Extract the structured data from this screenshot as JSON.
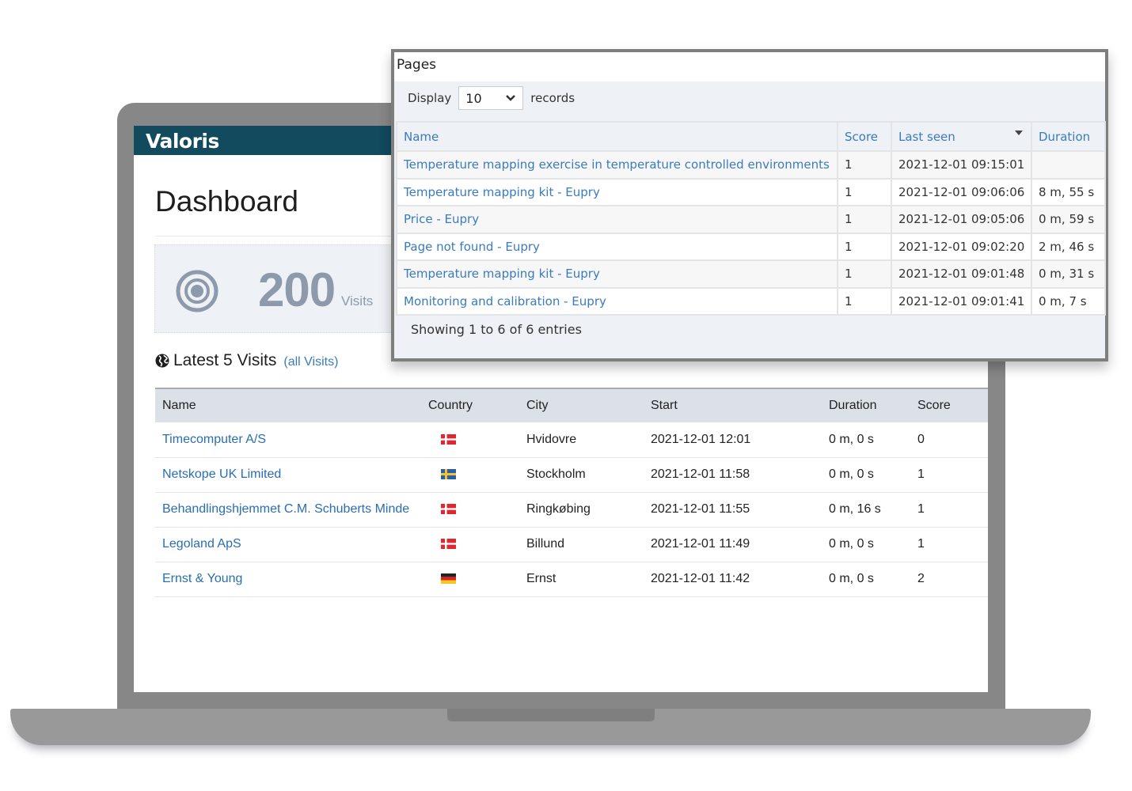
{
  "app": {
    "brand": "Valoris",
    "page_title": "Dashboard"
  },
  "stats": {
    "visits_value": "200",
    "visits_label": "Visits",
    "icon": "target-icon"
  },
  "latest_visits": {
    "heading": "Latest 5 Visits",
    "link_label": "(all Visits)",
    "icon": "globe-icon",
    "columns": [
      "Name",
      "Country",
      "City",
      "Start",
      "Duration",
      "Score"
    ],
    "rows": [
      {
        "name": "Timecomputer A/S",
        "country": "denmark",
        "city": "Hvidovre",
        "start": "2021-12-01 12:01",
        "duration": "0 m, 0 s",
        "score": "0"
      },
      {
        "name": "Netskope UK Limited",
        "country": "sweden",
        "city": "Stockholm",
        "start": "2021-12-01 11:58",
        "duration": "0 m, 0 s",
        "score": "1"
      },
      {
        "name": "Behandlingshjemmet C.M. Schuberts Minde",
        "country": "denmark",
        "city": "Ringkøbing",
        "start": "2021-12-01 11:55",
        "duration": "0 m, 16 s",
        "score": "1"
      },
      {
        "name": "Legoland ApS",
        "country": "denmark",
        "city": "Billund",
        "start": "2021-12-01 11:49",
        "duration": "0 m, 0 s",
        "score": "1"
      },
      {
        "name": "Ernst & Young",
        "country": "germany",
        "city": "Ernst",
        "start": "2021-12-01 11:42",
        "duration": "0 m, 0 s",
        "score": "2"
      }
    ]
  },
  "pages_popup": {
    "title": "Pages",
    "display_label": "Display",
    "display_value": "10",
    "records_label": "records",
    "columns": [
      "Name",
      "Score",
      "Last seen",
      "Duration"
    ],
    "sorted_column": "Last seen",
    "rows": [
      {
        "name": "Temperature mapping exercise in temperature controlled environments",
        "score": "1",
        "last_seen": "2021-12-01 09:15:01",
        "duration": ""
      },
      {
        "name": "Temperature mapping kit - Eupry",
        "score": "1",
        "last_seen": "2021-12-01 09:06:06",
        "duration": "8 m, 55 s"
      },
      {
        "name": "Price - Eupry",
        "score": "1",
        "last_seen": "2021-12-01 09:05:06",
        "duration": "0 m, 59 s"
      },
      {
        "name": "Page not found - Eupry",
        "score": "1",
        "last_seen": "2021-12-01 09:02:20",
        "duration": "2 m, 46 s"
      },
      {
        "name": "Temperature mapping kit - Eupry",
        "score": "1",
        "last_seen": "2021-12-01 09:01:48",
        "duration": "0 m, 31 s"
      },
      {
        "name": "Monitoring and calibration - Eupry",
        "score": "1",
        "last_seen": "2021-12-01 09:01:41",
        "duration": "0 m, 7 s"
      }
    ],
    "entries_info": "Showing 1 to 6 of 6 entries"
  },
  "colors": {
    "header_bg": "#124a5e",
    "link": "#2a6db3",
    "stat_text": "#8c9aab",
    "table_header_bg": "#dce1e8"
  }
}
